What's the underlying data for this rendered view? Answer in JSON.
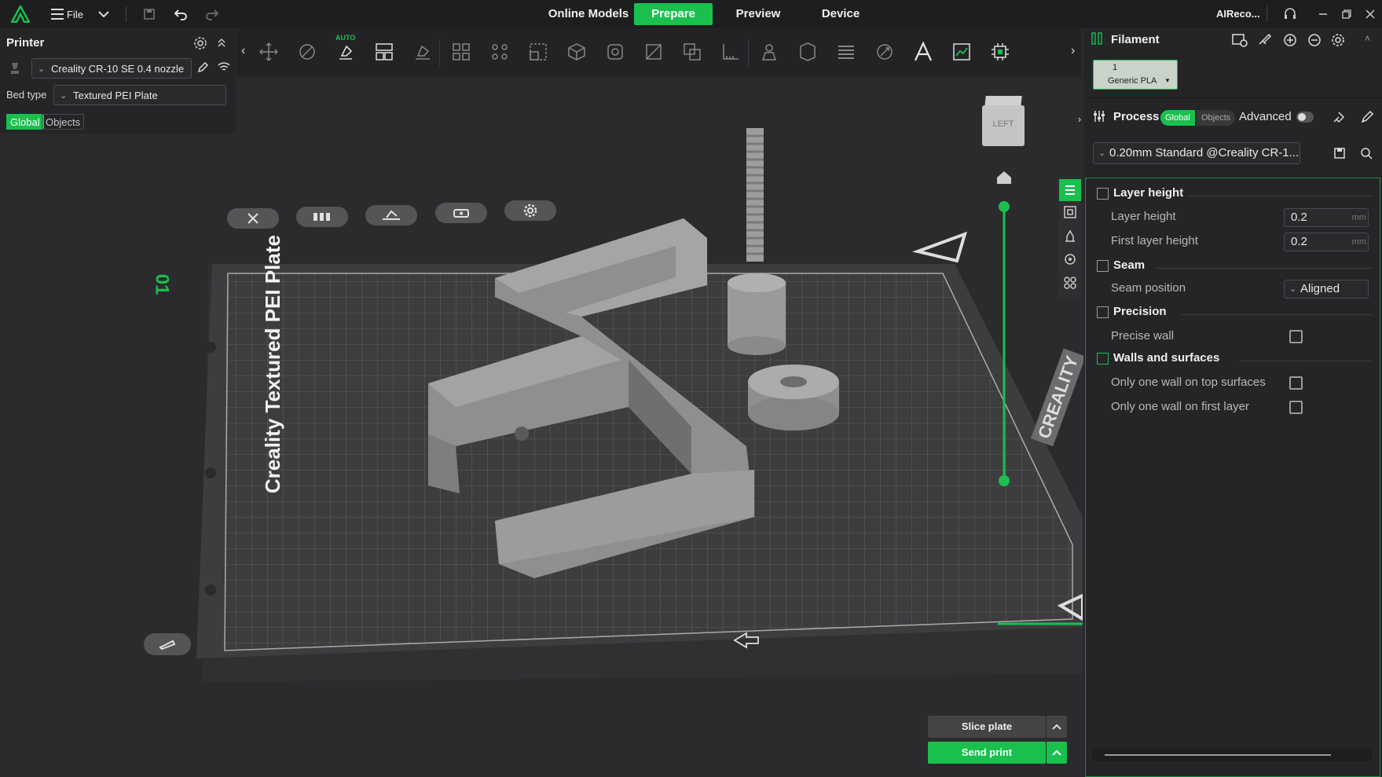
{
  "topbar": {
    "file_label": "File",
    "tabs": [
      {
        "label": "Online Models",
        "active": false
      },
      {
        "label": "Prepare",
        "active": true
      },
      {
        "label": "Preview",
        "active": false
      },
      {
        "label": "Device",
        "active": false
      }
    ],
    "user_label": "AIReco...",
    "accent_color": "#19c04e"
  },
  "printer": {
    "title": "Printer",
    "printer_name": "Creality CR-10 SE 0.4 nozzle",
    "bed_type_label": "Bed type",
    "bed_type_value": "Textured PEI Plate",
    "scope": {
      "global": "Global",
      "objects": "Objects"
    }
  },
  "toolbar": {
    "auto_label": "AUTO",
    "icons": [
      "move-icon",
      "rotate-icon",
      "auto-orient-icon",
      "arrange-icon",
      "lay-on-face-icon",
      "split-objects-icon",
      "split-parts-icon",
      "scale-icon",
      "support-paint-icon",
      "seam-paint-icon",
      "cut-icon",
      "boolean-icon",
      "measure-icon",
      "emboss-icon",
      "assembly-icon",
      "layers-icon",
      "variable-layer-icon",
      "text-icon",
      "plate-icon",
      "slice-all-icon"
    ]
  },
  "viewport": {
    "plate_text": "Creality Textured PEI Plate",
    "plate_number": "01",
    "brand_text": "CREALITY",
    "view_cube_label": "LEFT"
  },
  "filament": {
    "title": "Filament",
    "slot_number": "1",
    "slot_material": "Generic PLA"
  },
  "process": {
    "title": "Process",
    "scope": {
      "global": "Global",
      "objects": "Objects"
    },
    "advanced_label": "Advanced",
    "preset": "0.20mm Standard @Creality CR-1...",
    "sections": {
      "layer_height": {
        "title": "Layer height",
        "layer_height_label": "Layer height",
        "layer_height_value": "0.2",
        "first_layer_height_label": "First layer height",
        "first_layer_height_value": "0.2",
        "unit": "mm"
      },
      "seam": {
        "title": "Seam",
        "seam_position_label": "Seam position",
        "seam_position_value": "Aligned"
      },
      "precision": {
        "title": "Precision",
        "precise_wall_label": "Precise wall",
        "precise_wall_checked": false
      },
      "walls": {
        "title": "Walls and surfaces",
        "one_wall_top_label": "Only one wall on top surfaces",
        "one_wall_top_checked": false,
        "one_wall_first_label": "Only one wall on first layer",
        "one_wall_first_checked": false
      }
    }
  },
  "actions": {
    "slice_label": "Slice plate",
    "send_label": "Send print"
  }
}
